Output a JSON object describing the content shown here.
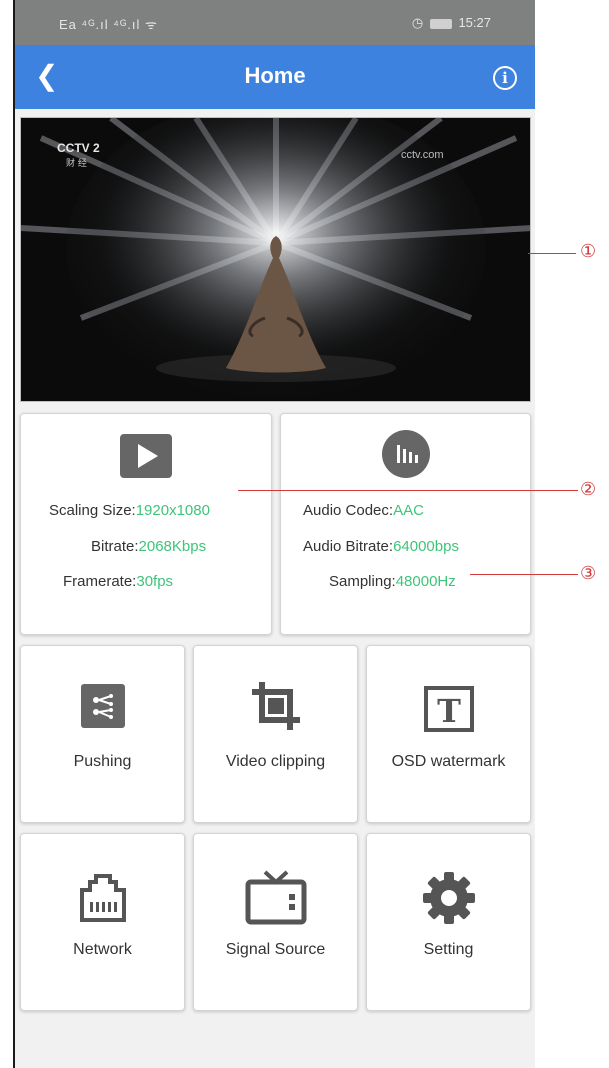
{
  "status_bar": {
    "left_icons": "Ea ⁴ᴳ.ıl ⁴ᴳ.ıl ᯤ",
    "time": "15:27",
    "battery_icon": "battery-icon",
    "alarm_icon": "alarm-icon"
  },
  "app_bar": {
    "title": "Home",
    "back_icon": "back-arrow-icon",
    "info_icon": "info-icon"
  },
  "video": {
    "channel_logo": "CCTV 2",
    "channel_sub": "财 经",
    "watermark": "cctv.com"
  },
  "video_info": {
    "scaling_label": "Scaling Size:",
    "scaling_value": "1920x1080",
    "bitrate_label": "Bitrate:",
    "bitrate_value": "2068Kbps",
    "framerate_label": "Framerate:",
    "framerate_value": "30fps"
  },
  "audio_info": {
    "codec_label": "Audio Codec:",
    "codec_value": "AAC",
    "bitrate_label": "Audio Bitrate:",
    "bitrate_value": "64000bps",
    "sampling_label": "Sampling:",
    "sampling_value": "48000Hz"
  },
  "tiles": [
    {
      "label": "Pushing",
      "icon": "pushing-icon"
    },
    {
      "label": "Video clipping",
      "icon": "crop-icon"
    },
    {
      "label": "OSD watermark",
      "icon": "text-watermark-icon"
    },
    {
      "label": "Network",
      "icon": "network-port-icon"
    },
    {
      "label": "Signal Source",
      "icon": "tv-icon"
    },
    {
      "label": "Setting",
      "icon": "gear-icon"
    }
  ],
  "callouts": [
    "①",
    "②",
    "③"
  ],
  "colors": {
    "app_bar": "#3e82e0",
    "value_green": "#3fc47a",
    "callout_red": "#d23a3a"
  }
}
